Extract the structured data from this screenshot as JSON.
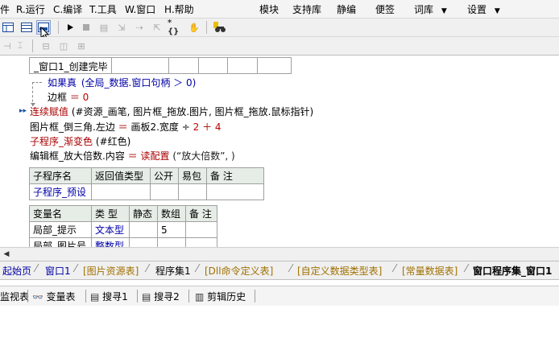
{
  "menu": {
    "items_left": [
      {
        "key": "menu-file-partial",
        "label": "件"
      },
      {
        "key": "menu-run",
        "label": "R.运行"
      },
      {
        "key": "menu-compile",
        "label": "C.编译"
      },
      {
        "key": "menu-tools",
        "label": "T.工具"
      },
      {
        "key": "menu-window",
        "label": "W.窗口"
      },
      {
        "key": "menu-help",
        "label": "H.帮助"
      }
    ],
    "items_right": [
      {
        "key": "menu-module",
        "label": "模块"
      },
      {
        "key": "menu-support-lib",
        "label": "支持库"
      },
      {
        "key": "menu-static",
        "label": "静编"
      },
      {
        "key": "menu-note",
        "label": "便签"
      },
      {
        "key": "menu-lexicon",
        "label": "词库",
        "dropdown": "▼"
      },
      {
        "key": "menu-settings",
        "label": "设置",
        "dropdown": "▼"
      }
    ]
  },
  "editor": {
    "header_cell": "_窗口1_创建完毕",
    "lines": {
      "if_kw": "如果真",
      "if_cond": "(全局_数据.窗口句柄 ＞ 0)",
      "margin_var": "边框",
      "margin_eq": " ＝ ",
      "margin_val": "0",
      "cont_kw": "连续赋值",
      "cont_args": "(#资源_画笔, 图片框_拖放.图片, 图片框_拖放.鼠标指针)",
      "tri_lhs": "图片框_倒三角.左边",
      "tri_eq": " ＝ ",
      "tri_rhs": "画板2.宽度 ÷ ",
      "tri_n1": "2",
      "tri_plus": " ＋ ",
      "tri_n2": "4",
      "grad_call": "子程序_渐变色",
      "grad_args": "(#红色)",
      "zoom_lhs": "编辑框_放大倍数.内容",
      "zoom_eq": " ＝ ",
      "zoom_fn": "读配置",
      "zoom_args": "(“放大倍数”, )"
    },
    "sub_table": {
      "headers": [
        "子程序名",
        "返回值类型",
        "公开",
        "易包",
        "备 注"
      ],
      "rows": [
        [
          "子程序_预设",
          "",
          "",
          "",
          ""
        ]
      ]
    },
    "var_table": {
      "headers": [
        "变量名",
        "类 型",
        "静态",
        "数组",
        "备 注"
      ],
      "rows": [
        [
          "局部_提示",
          "文本型",
          "",
          "5",
          ""
        ],
        [
          "局部_图片号",
          "整数型",
          "",
          "",
          ""
        ]
      ]
    }
  },
  "tabs": [
    {
      "label": "起始页",
      "style": "blue"
    },
    {
      "label": "窗口1",
      "style": "blue"
    },
    {
      "label": "[图片资源表]",
      "style": "yellow"
    },
    {
      "label": "程序集1",
      "style": "plain"
    },
    {
      "label": "[Dll命令定义表]",
      "style": "yellow"
    },
    {
      "label": "[自定义数据类型表]",
      "style": "yellow"
    },
    {
      "label": "[常量数据表]",
      "style": "yellow"
    },
    {
      "label": "窗口程序集_窗口1",
      "style": "active"
    }
  ],
  "bottom_tabs": [
    {
      "key": "watch",
      "label": "监视表"
    },
    {
      "key": "vars",
      "label": "变量表",
      "icon": "glasses-icon"
    },
    {
      "key": "search1",
      "label": "搜寻1",
      "icon": "search-doc-icon"
    },
    {
      "key": "search2",
      "label": "搜寻2",
      "icon": "search-doc-icon"
    },
    {
      "key": "clipboard",
      "label": "剪辑历史",
      "icon": "clipboard-icon"
    }
  ],
  "colors": {
    "keyword_blue": "#0000a8",
    "keyword_red": "#a80000",
    "tab_yellow": "#a07000"
  }
}
